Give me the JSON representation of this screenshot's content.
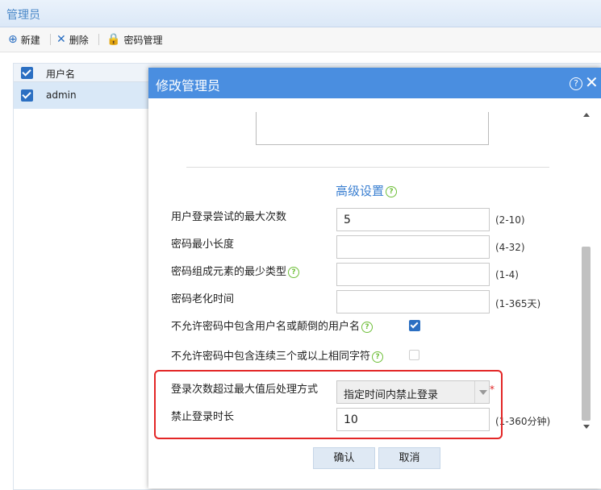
{
  "window": {
    "title": "管理员"
  },
  "toolbar": {
    "new_label": "新建",
    "delete_label": "删除",
    "password_label": "密码管理"
  },
  "list": {
    "header_username": "用户名",
    "rows": [
      {
        "username": "admin",
        "checked": true
      }
    ]
  },
  "dialog": {
    "title": "修改管理员",
    "section_title": "高级设置",
    "fields": {
      "max_attempts": {
        "label": "用户登录尝试的最大次数",
        "value": "5",
        "hint": "(2-10)"
      },
      "min_length": {
        "label": "密码最小长度",
        "value": "",
        "hint": "(4-32)"
      },
      "min_types": {
        "label": "密码组成元素的最少类型",
        "value": "",
        "hint": "(1-4)"
      },
      "aging": {
        "label": "密码老化时间",
        "value": "",
        "hint": "(1-365天)"
      },
      "no_username": {
        "label": "不允许密码中包含用户名或颠倒的用户名",
        "checked": true
      },
      "no_repeat": {
        "label": "不允许密码中包含连续三个或以上相同字符",
        "checked": false
      },
      "over_limit_action": {
        "label": "登录次数超过最大值后处理方式",
        "selected": "指定时间内禁止登录",
        "required_mark": "*"
      },
      "ban_duration": {
        "label": "禁止登录时长",
        "value": "10",
        "hint": "(1-360分钟)"
      }
    },
    "confirm_label": "确认",
    "cancel_label": "取消"
  },
  "colors": {
    "accent": "#4a8ee0",
    "highlight_box": "#e32626",
    "help_icon": "#6fbf3a"
  }
}
